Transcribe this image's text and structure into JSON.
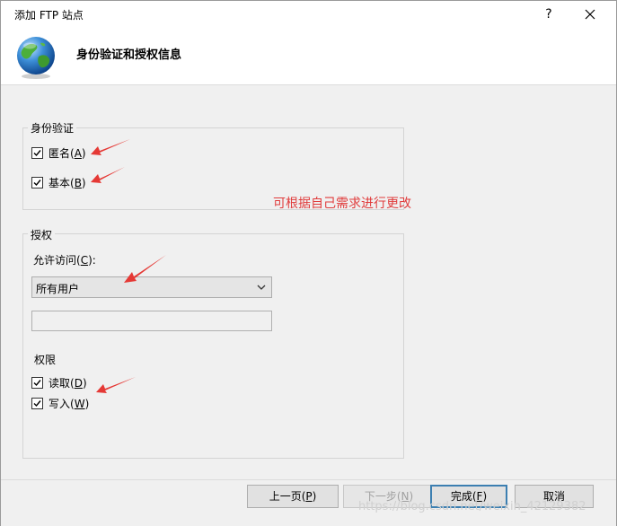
{
  "window": {
    "title": "添加 FTP 站点",
    "help_label": "?",
    "header_title": "身份验证和授权信息"
  },
  "authentication": {
    "group_label": "身份验证",
    "anonymous": {
      "label": "匿名(",
      "key": "A",
      "end": ")",
      "checked": true
    },
    "basic": {
      "label": "基本(",
      "key": "B",
      "end": ")",
      "checked": true
    }
  },
  "annotation": {
    "note": "可根据自己需求进行更改",
    "color": "#e03c3c"
  },
  "authorization": {
    "group_label": "授权",
    "allow_access": {
      "label": "允许访问(",
      "key": "C",
      "end": "):"
    },
    "allow_access_value": "所有用户",
    "user_field_value": "",
    "permissions_label": "权限",
    "read": {
      "label": "读取(",
      "key": "D",
      "end": ")",
      "checked": true
    },
    "write": {
      "label": "写入(",
      "key": "W",
      "end": ")",
      "checked": true
    }
  },
  "footer": {
    "prev": {
      "label": "上一页(",
      "key": "P",
      "end": ")"
    },
    "next": {
      "label": "下一步(",
      "key": "N",
      "end": ")"
    },
    "finish": {
      "label": "完成(",
      "key": "F",
      "end": ")"
    },
    "cancel": "取消"
  },
  "watermark": "https://blog.csdn.net/weixin_42129382",
  "colors": {
    "accent": "#3c7fb1",
    "dialog_bg": "#f0f0f0"
  },
  "icons": {
    "header": "globe-icon",
    "close": "close-icon",
    "dropdown": "chevron-down-icon",
    "checkbox": "checkmark-icon",
    "arrow": "red-arrow-icon"
  }
}
